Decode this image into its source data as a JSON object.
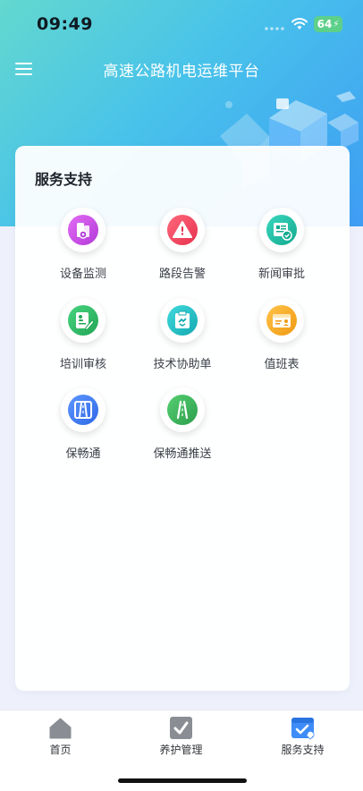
{
  "status_bar": {
    "time": "09:49",
    "battery": "64"
  },
  "header": {
    "title": "高速公路机电运维平台"
  },
  "section": {
    "title": "服务支持",
    "items": [
      {
        "label": "设备监测",
        "icon": "device-monitor-icon",
        "color": "#c84ee8"
      },
      {
        "label": "路段告警",
        "icon": "warning-icon",
        "color": "#f0445f"
      },
      {
        "label": "新闻审批",
        "icon": "news-approval-icon",
        "color": "#21c0a6"
      },
      {
        "label": "培训审核",
        "icon": "training-review-icon",
        "color": "#2fbe6a"
      },
      {
        "label": "技术协助单",
        "icon": "tech-assist-icon",
        "color": "#22c3c8"
      },
      {
        "label": "值班表",
        "icon": "duty-roster-icon",
        "color": "#f5a623"
      },
      {
        "label": "保畅通",
        "icon": "road-icon",
        "color": "#3e7cf6"
      },
      {
        "label": "保畅通推送",
        "icon": "road-push-icon",
        "color": "#3ab85c"
      }
    ]
  },
  "tabbar": {
    "tabs": [
      {
        "label": "首页",
        "icon": "home-icon"
      },
      {
        "label": "养护管理",
        "icon": "maintenance-icon"
      },
      {
        "label": "服务支持",
        "icon": "service-support-icon"
      }
    ],
    "colors": {
      "inactive": "#8a8d93",
      "active": "#3e8cf7"
    }
  }
}
